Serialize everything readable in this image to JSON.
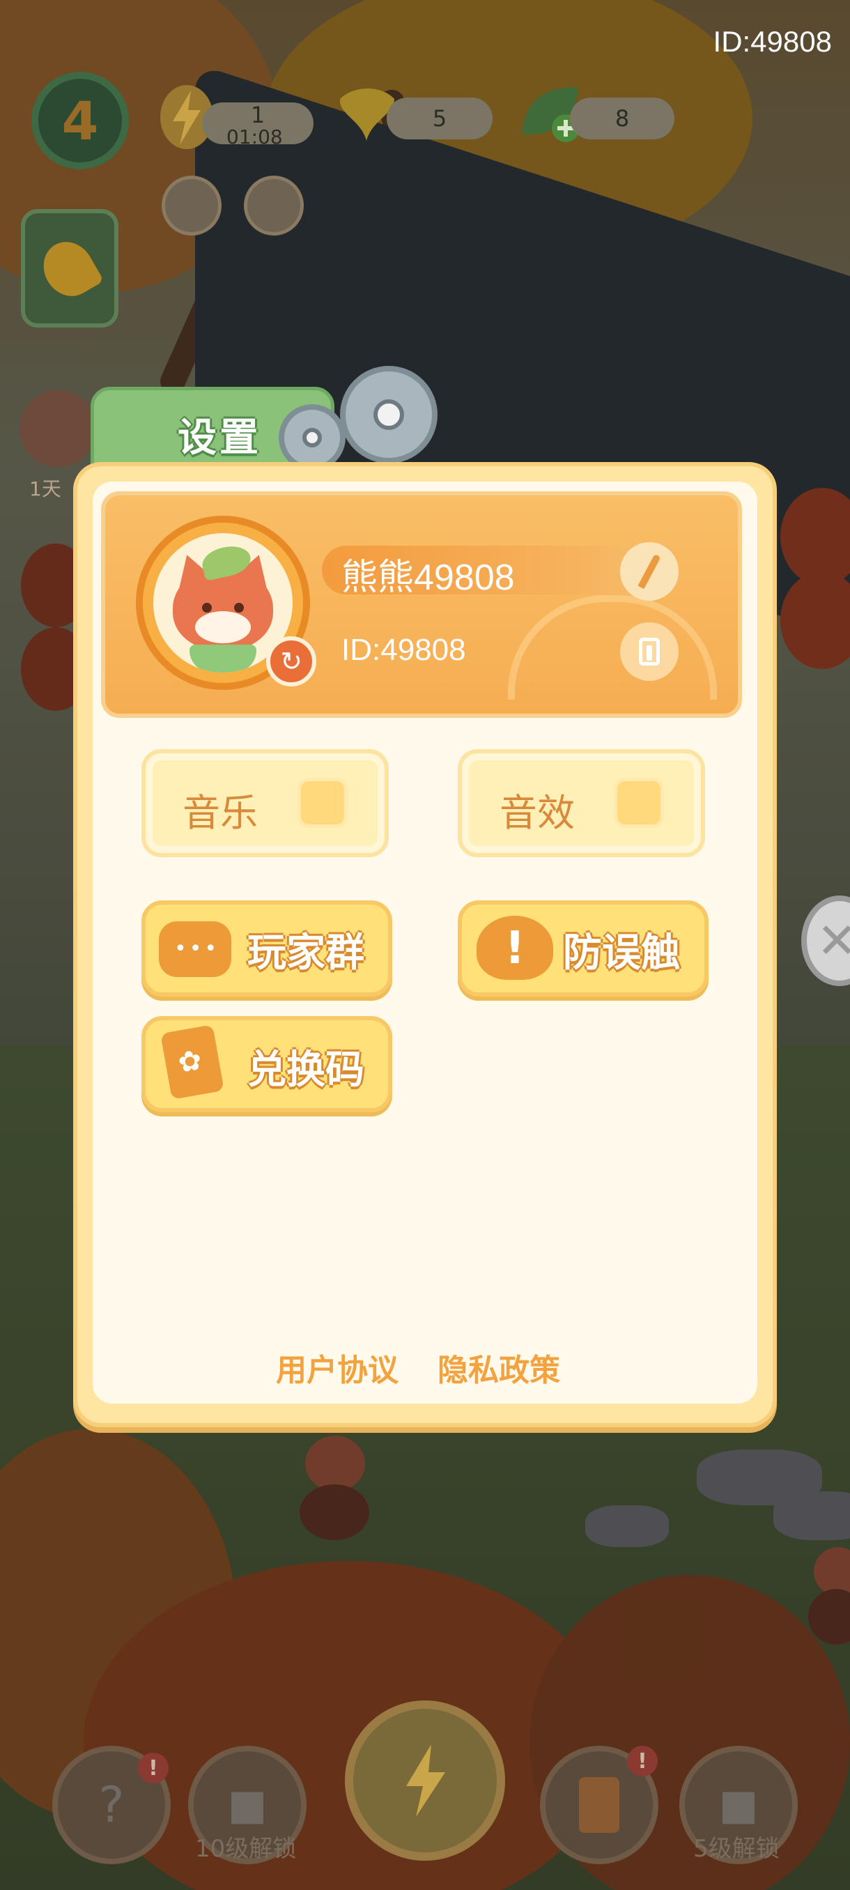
{
  "top_id": "ID:49808",
  "hud": {
    "level": "4",
    "energy_count": "1",
    "energy_timer": "01:08",
    "ginkgo_count": "5",
    "leaf_count": "8",
    "event_label": "1天"
  },
  "settings": {
    "title": "设置",
    "profile": {
      "nickname": "熊熊49808",
      "id_text": "ID:49808"
    },
    "toggles": {
      "music_label": "音乐",
      "sfx_label": "音效"
    },
    "actions": {
      "player_group_label": "玩家群",
      "anti_mistouch_label": "防误触",
      "redeem_code_label": "兑换码"
    },
    "footer": {
      "user_agreement": "用户协议",
      "privacy_policy": "隐私政策"
    }
  },
  "bottom_bar": {
    "unlock_left_label": "10级解锁",
    "unlock_right_label": "5级解锁"
  },
  "colors": {
    "accent_orange": "#f6ad52",
    "tab_green": "#8bc27a",
    "panel_cream": "#fffaeb"
  }
}
